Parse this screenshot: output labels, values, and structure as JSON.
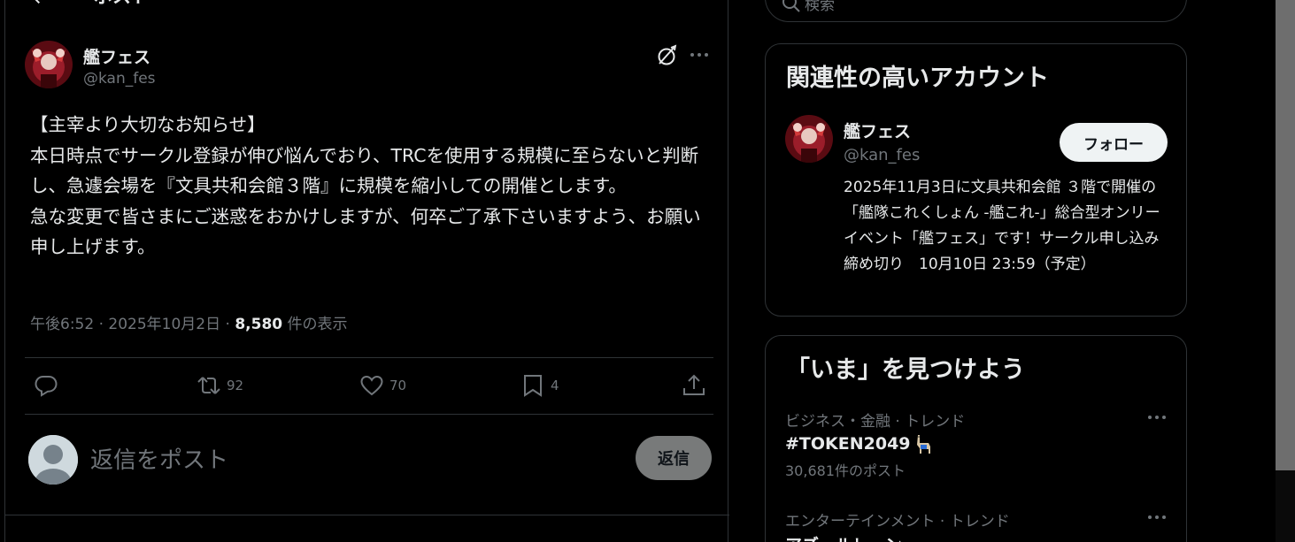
{
  "header": {
    "title": "ポスト"
  },
  "post": {
    "author_name": "艦フェス",
    "author_handle": "@kan_fes",
    "body": "【主宰より大切なお知らせ】\n本日時点でサークル登録が伸び悩んでおり、TRCを使用する規模に至らないと判断し、急遽会場を『文具共和会館３階』に規模を縮小しての開催とします。\n急な変更で皆さまにご迷惑をおかけしますが、何卒ご了承下さいますよう、お願い申し上げます。",
    "time": "午後6:52",
    "date": "2025年10月2日",
    "views_count": "8,580",
    "views_label": "件の表示",
    "separator": "·",
    "retweets": "92",
    "likes": "70",
    "bookmarks": "4"
  },
  "reply": {
    "placeholder": "返信をポスト",
    "button_label": "返信"
  },
  "search": {
    "placeholder": "検索"
  },
  "related": {
    "title": "関連性の高いアカウント",
    "account": {
      "name": "艦フェス",
      "handle": "@kan_fes",
      "follow_label": "フォロー",
      "bio": "2025年11月3日に文具共和会館 ３階で開催の「艦隊これくしょん -艦これ-」総合型オンリーイベント「艦フェス」です！サークル申し込み締め切り　10月10日 23:59（予定）"
    }
  },
  "explore": {
    "title": "「いま」を見つけよう",
    "trends": [
      {
        "category": "ビジネス・金融 · トレンド",
        "name": "#TOKEN2049",
        "count": "30,681件のポスト"
      },
      {
        "category": "エンターテインメント · トレンド",
        "name": "アズールレーン",
        "count": ""
      }
    ]
  },
  "colors": {
    "background": "#000000",
    "text": "#e7e9ea",
    "muted": "#71767b",
    "border": "#2f3336",
    "follow_bg": "#eff3f4",
    "reply_button_bg": "#787a7a"
  }
}
